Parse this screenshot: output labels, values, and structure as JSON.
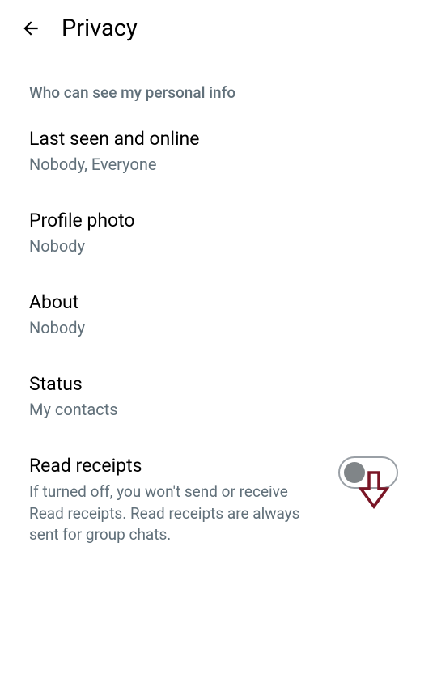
{
  "header": {
    "title": "Privacy"
  },
  "sectionHeader": "Who can see my personal info",
  "settings": {
    "lastSeen": {
      "title": "Last seen and online",
      "value": "Nobody, Everyone"
    },
    "profilePhoto": {
      "title": "Profile photo",
      "value": "Nobody"
    },
    "about": {
      "title": "About",
      "value": "Nobody"
    },
    "status": {
      "title": "Status",
      "value": "My contacts"
    },
    "readReceipts": {
      "title": "Read receipts",
      "description": "If turned off, you won't send or receive Read receipts. Read receipts are always sent for group chats.",
      "enabled": false
    }
  }
}
